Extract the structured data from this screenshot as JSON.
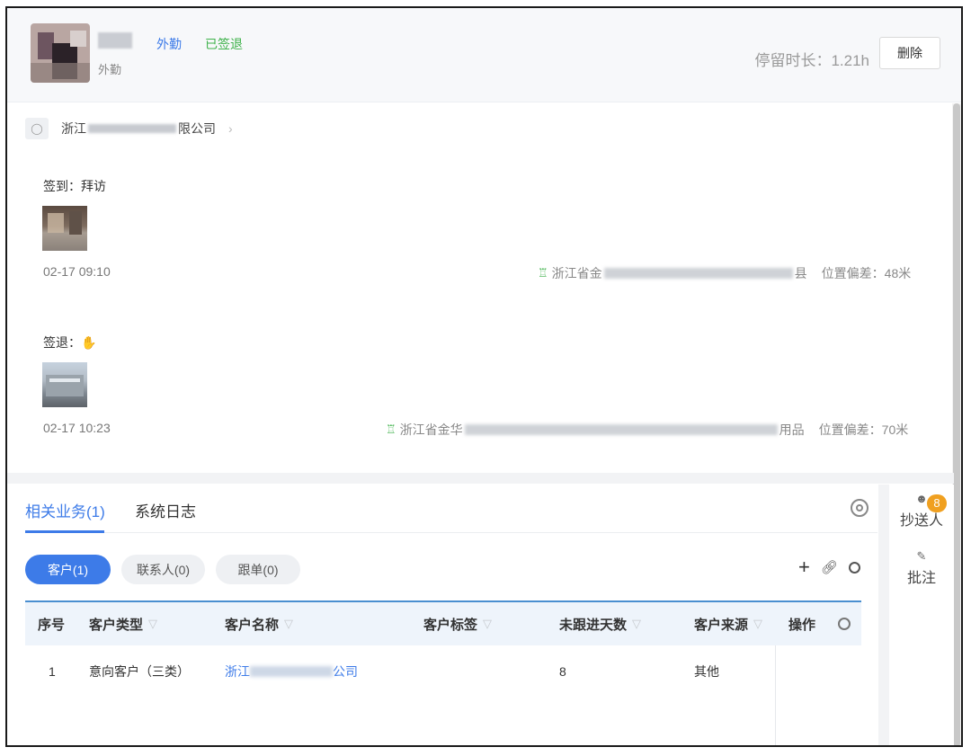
{
  "header": {
    "name_sub": "外勤",
    "tag_type": "外勤",
    "tag_status": "已签退",
    "duration_label": "停留时长：1.21h",
    "delete_label": "删除"
  },
  "company": {
    "name_prefix": "浙江",
    "name_suffix": "限公司"
  },
  "checkin": {
    "label": "签到：拜访",
    "time": "02-17 09:10",
    "location_prefix": "浙江省金",
    "location_suffix": "县",
    "deviation": "位置偏差：48米"
  },
  "checkout": {
    "label": "签退：",
    "time": "02-17 10:23",
    "location_prefix": "浙江省金华",
    "location_suffix": "用品",
    "deviation": "位置偏差：70米"
  },
  "tabs": [
    {
      "label": "相关业务(1)",
      "active": true
    },
    {
      "label": "系统日志",
      "active": false
    }
  ],
  "pills": [
    {
      "label": "客户(1)",
      "active": true
    },
    {
      "label": "联系人(0)",
      "active": false
    },
    {
      "label": "跟单(0)",
      "active": false
    }
  ],
  "table": {
    "columns": [
      "序号",
      "客户类型",
      "客户名称",
      "客户标签",
      "未跟进天数",
      "客户来源",
      "操作"
    ],
    "rows": [
      {
        "index": "1",
        "type": "意向客户（三类）",
        "name_prefix": "浙江",
        "name_suffix": "公司",
        "tag": "",
        "days": "8",
        "source": "其他"
      }
    ]
  },
  "side": {
    "cc_label": "抄送人",
    "cc_badge": "8",
    "comment_label": "批注"
  },
  "colors": {
    "accent": "#3d7be8",
    "success": "#3fb24b",
    "badge": "#f0a020"
  },
  "icons": {
    "company": "company-icon",
    "location": "location-pin-icon",
    "hand": "hand-icon",
    "settings": "settings-icon",
    "add": "plus-icon",
    "link": "link-icon",
    "filter": "filter-icon",
    "person": "person-icon",
    "comment": "comment-icon"
  }
}
